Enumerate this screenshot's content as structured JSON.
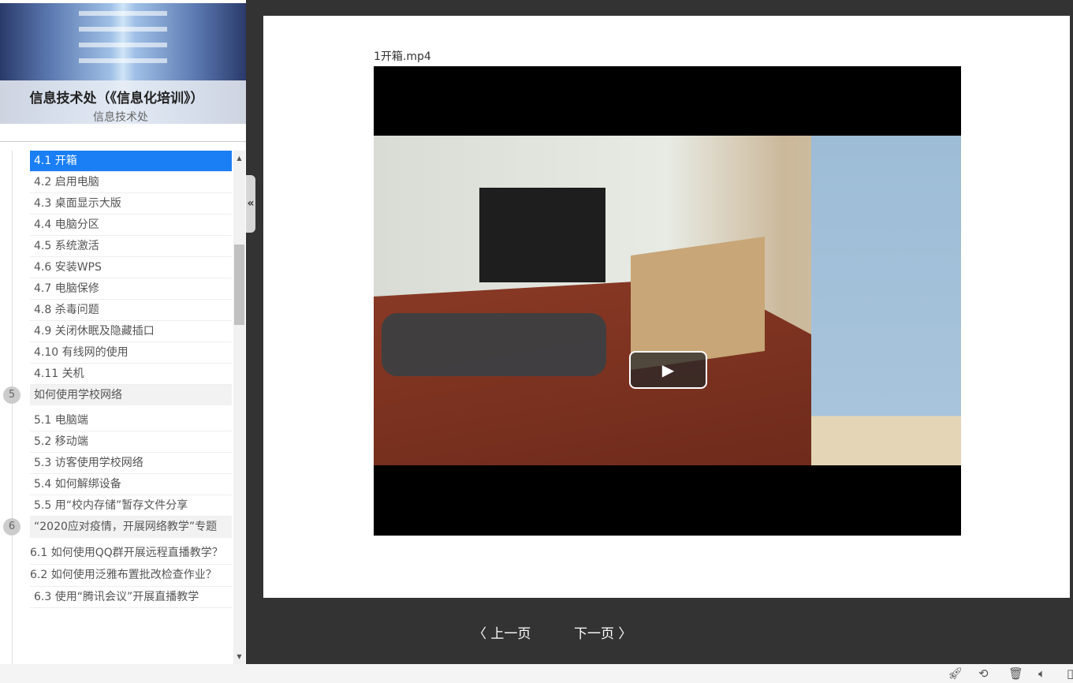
{
  "course": {
    "title": "信息技术处（《信息化培训》）",
    "subtitle": "信息技术处"
  },
  "toc": {
    "ch4_items": [
      "4.1  开箱",
      "4.2  启用电脑",
      "4.3  桌面显示大版",
      "4.4  电脑分区",
      "4.5  系统激活",
      "4.6  安装WPS",
      "4.7  电脑保修",
      "4.8  杀毒问题",
      "4.9  关闭休眠及隐藏插口",
      "4.10  有线网的使用",
      "4.11  关机"
    ],
    "ch5": {
      "num": "5",
      "title": "如何使用学校网络"
    },
    "ch5_items": [
      "5.1  电脑端",
      "5.2  移动端",
      "5.3  访客使用学校网络",
      "5.4  如何解绑设备",
      "5.5  用“校内存储”暂存文件分享"
    ],
    "ch6": {
      "num": "6",
      "title": "“2020应对疫情，开展网络教学”专题"
    },
    "ch6_items": [
      "6.1  如何使用QQ群开展远程直播教学？",
      "6.2  如何使用泛雅布置批改检查作业？",
      "6.3  使用“腾讯会议”开展直播教学"
    ],
    "collapse": "«"
  },
  "video": {
    "filename": "1开箱.mp4",
    "play": "▶"
  },
  "nav": {
    "prev": "上一页",
    "next": "下一页"
  }
}
